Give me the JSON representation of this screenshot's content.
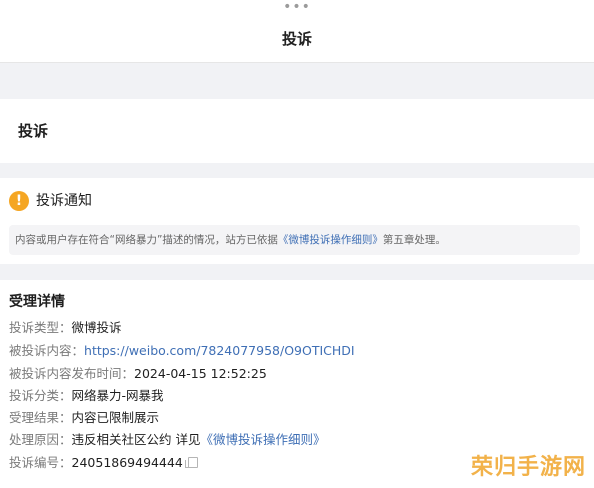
{
  "header": {
    "more_dots": "•••",
    "title": "投诉"
  },
  "section": {
    "heading": "投诉"
  },
  "notice": {
    "icon": "exclamation-icon",
    "accent_color": "#f5a623",
    "title": "投诉通知",
    "body_prefix": "内容或用户存在符合“网络暴力”描述的情况，站方已依据",
    "body_link": "《微博投诉操作细则》",
    "body_suffix": "第五章处理。"
  },
  "details": {
    "title": "受理详情",
    "rows": [
      {
        "label": "投诉类型：",
        "value": "微博投诉"
      },
      {
        "label": "被投诉内容：",
        "value": "https://weibo.com/7824077958/O9OTICHDI"
      },
      {
        "label": "被投诉内容发布时间：",
        "value": "2024-04-15 12:52:25"
      },
      {
        "label": "投诉分类：",
        "value": "网络暴力-网暴我"
      },
      {
        "label": "受理结果：",
        "value": "内容已限制展示"
      },
      {
        "label": "处理原因：",
        "value_prefix": "违反相关社区公约 详见",
        "value_link": "《微博投诉操作细则》"
      },
      {
        "label": "投诉编号：",
        "value": "24051869494444"
      }
    ]
  },
  "watermark": {
    "text": "荣归手游网",
    "color": "#f2b24a"
  },
  "link_color": "#3f6fb5"
}
